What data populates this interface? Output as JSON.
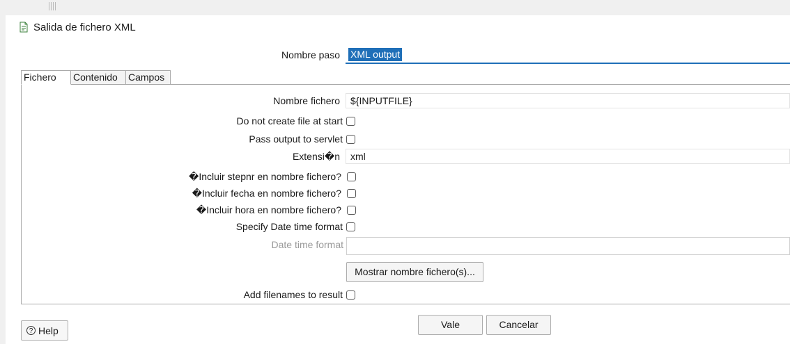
{
  "window": {
    "title": "Salida de fichero XML",
    "icon": "xml-file-icon"
  },
  "step": {
    "label": "Nombre paso",
    "value": "XML output"
  },
  "tabs": [
    {
      "label": "Fichero",
      "active": true
    },
    {
      "label": "Contenido",
      "active": false
    },
    {
      "label": "Campos",
      "active": false
    }
  ],
  "fichero": {
    "filename_label": "Nombre fichero",
    "filename_value": "${INPUTFILE}",
    "no_create_label": "Do not create file at start",
    "no_create_checked": false,
    "servlet_label": "Pass output to servlet",
    "servlet_checked": false,
    "extension_label": "Extensi�n",
    "extension_value": "xml",
    "stepnr_label": "�Incluir stepnr en nombre fichero?",
    "stepnr_checked": false,
    "fecha_label": "�Incluir fecha en nombre fichero?",
    "fecha_checked": false,
    "hora_label": "�Incluir hora en nombre fichero?",
    "hora_checked": false,
    "specify_dt_label": "Specify Date time format",
    "specify_dt_checked": false,
    "dt_format_label": "Date time format",
    "dt_format_value": "",
    "show_filenames_button": "Mostrar nombre fichero(s)...",
    "add_result_label": "Add filenames to result",
    "add_result_checked": false
  },
  "footer": {
    "help_label": "Help",
    "ok_label": "Vale",
    "cancel_label": "Cancelar"
  }
}
